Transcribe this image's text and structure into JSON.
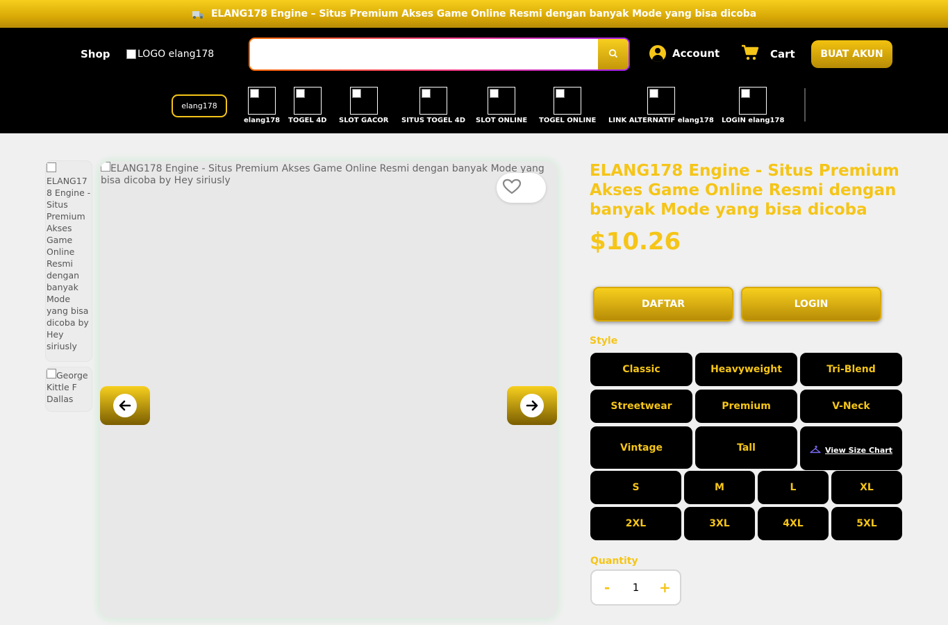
{
  "announcement": {
    "icon": "truck-icon",
    "text": "ELANG178 Engine – Situs Premium Akses Game Online Resmi dengan banyak Mode yang bisa dicoba"
  },
  "header": {
    "shop_label": "Shop",
    "logo_alt": "LOGO elang178",
    "search": {
      "placeholder": "",
      "icon": "search-icon"
    },
    "account_label": "Account",
    "cart_label": "Cart",
    "signup_label": "BUAT AKUN"
  },
  "nav": {
    "chip_label": "elang178",
    "items": [
      {
        "label": "elang178"
      },
      {
        "label": "TOGEL 4D"
      },
      {
        "label": "SLOT GACOR"
      },
      {
        "label": "SITUS TOGEL 4D"
      },
      {
        "label": "SLOT ONLINE"
      },
      {
        "label": "TOGEL ONLINE"
      },
      {
        "label": "LINK ALTERNATIF elang178"
      },
      {
        "label": "LOGIN elang178"
      }
    ]
  },
  "gallery": {
    "thumb1_alt": "ELANG178 Engine - Situs Premium Akses Game Online Resmi dengan banyak Mode yang bisa dicoba by Hey siriusly",
    "thumb2_alt": "George Kittle F Dallas",
    "main_alt": "ELANG178 Engine - Situs Premium Akses Game Online Resmi dengan banyak Mode yang bisa dicoba by Hey siriusly"
  },
  "product": {
    "title": "ELANG178 Engine - Situs Premium Akses Game Online Resmi dengan banyak Mode yang bisa dicoba",
    "price": "$10.26",
    "daftar_label": "DAFTAR",
    "login_label": "LOGIN",
    "style_label": "Style",
    "styles": [
      "Classic",
      "Heavyweight",
      "Tri-Blend",
      "Streetwear",
      "Premium",
      "V-Neck",
      "Vintage",
      "Tall"
    ],
    "size_chart_label": "View Size Chart",
    "sizes": [
      "S",
      "M",
      "L",
      "XL",
      "2XL",
      "3XL",
      "4XL",
      "5XL"
    ],
    "quantity_label": "Quantity",
    "quantity_minus": "-",
    "quantity_value": "1",
    "quantity_plus": "+"
  },
  "colors": {
    "brand_gold": "#f5c518",
    "header_bg": "#000000",
    "page_bg": "#f0f0f0"
  }
}
